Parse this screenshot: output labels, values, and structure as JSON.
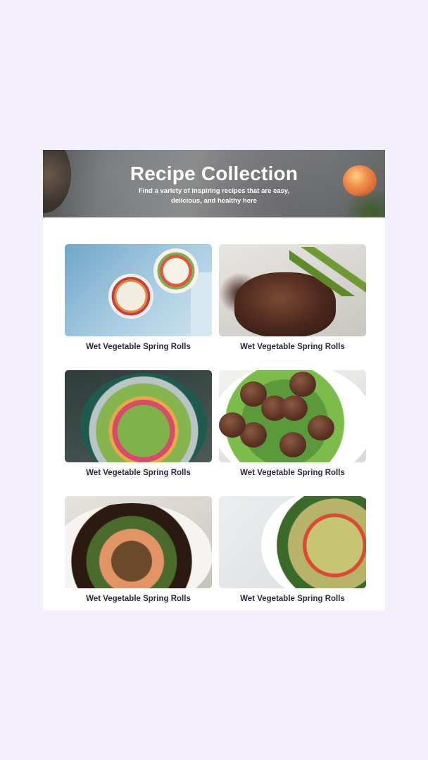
{
  "header": {
    "title": "Recipe Collection",
    "subtitle": "Find a variety of inspiring recipes that are easy, delicious, and healthy here"
  },
  "recipes": [
    {
      "label": "Wet Vegetable Spring Rolls",
      "image": "breakfast-bowls-image"
    },
    {
      "label": "Wet Vegetable Spring Rolls",
      "image": "steak-asparagus-image"
    },
    {
      "label": "Wet Vegetable Spring Rolls",
      "image": "hummus-salad-bowl-image"
    },
    {
      "label": "Wet Vegetable Spring Rolls",
      "image": "meatballs-greens-image"
    },
    {
      "label": "Wet Vegetable Spring Rolls",
      "image": "salmon-vegetables-image"
    },
    {
      "label": "Wet Vegetable Spring Rolls",
      "image": "pasta-salad-image"
    }
  ],
  "colors": {
    "page_background": "#f3f0fc",
    "card_background": "#ffffff",
    "label_text": "#2d2a45",
    "header_text": "#ffffff"
  }
}
